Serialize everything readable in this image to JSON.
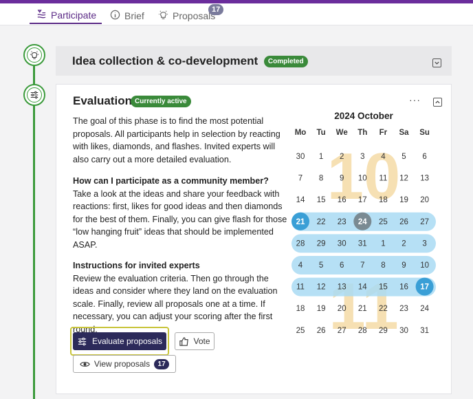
{
  "tabs": [
    {
      "label": "Participate",
      "icon": "participate-icon",
      "active": true
    },
    {
      "label": "Brief",
      "icon": "info-icon",
      "active": false
    },
    {
      "label": "Proposals",
      "icon": "lightbulb-icon",
      "active": false,
      "badge": "17"
    }
  ],
  "colors": {
    "accent": "#5b2a86",
    "green": "#3a9a3a",
    "navy": "#2c2a5a",
    "highlight": "#c8c43a",
    "range": "#a9daf3",
    "day_selected": "#3a9fd6",
    "today": "#7a8a92"
  },
  "phase1": {
    "title": "Idea collection & co-development",
    "status": "Completed",
    "icon": "lightbulb-icon"
  },
  "phase2": {
    "title": "Evaluation",
    "status": "Currently active",
    "icon": "sliders-icon",
    "menu": "···",
    "intro": "The goal of this phase is to find the most potential proposals. All participants help in selection by reacting with likes, diamonds, and flashes. Invited experts will also carry out a more detailed evaluation.",
    "community_heading": "How can I participate as a community member?",
    "community_text": "Take a look at the ideas and share your feedback with reactions: first, likes for good ideas and then diamonds for the best of them. Finally, you can give flash for those “low hanging fruit” ideas that should be implemented ASAP.",
    "experts_heading": "Instructions for invited experts",
    "experts_text": "Review the evaluation criteria. Then go through the ideas and consider where they land on the evaluation scale. Finally, review all proposals one at a time. If necessary, you can adjust your scoring after the first round.",
    "buttons": {
      "evaluate": "Evaluate proposals",
      "vote": "Vote",
      "view": "View proposals",
      "view_count": "17"
    }
  },
  "calendar": {
    "title": "2024 October",
    "weekdays": [
      "Mo",
      "Tu",
      "We",
      "Th",
      "Fr",
      "Sa",
      "Su"
    ],
    "watermarks": [
      "10",
      "11"
    ],
    "weeks": [
      [
        "30",
        "1",
        "2",
        "3",
        "4",
        "5",
        "6"
      ],
      [
        "7",
        "8",
        "9",
        "10",
        "11",
        "12",
        "13"
      ],
      [
        "14",
        "15",
        "16",
        "17",
        "18",
        "19",
        "20"
      ],
      [
        "21",
        "22",
        "23",
        "24",
        "25",
        "26",
        "27"
      ],
      [
        "28",
        "29",
        "30",
        "31",
        "1",
        "2",
        "3"
      ],
      [
        "4",
        "5",
        "6",
        "7",
        "8",
        "9",
        "10"
      ],
      [
        "11",
        "12",
        "13",
        "14",
        "15",
        "16",
        "17"
      ],
      [
        "18",
        "19",
        "20",
        "21",
        "22",
        "23",
        "24"
      ],
      [
        "25",
        "26",
        "27",
        "28",
        "29",
        "30",
        "31"
      ]
    ],
    "range_rows": [
      3,
      4,
      5,
      6
    ],
    "range_start": {
      "row": 3,
      "col": 0
    },
    "range_end": {
      "row": 6,
      "col": 6
    },
    "today": {
      "row": 3,
      "col": 3
    }
  }
}
